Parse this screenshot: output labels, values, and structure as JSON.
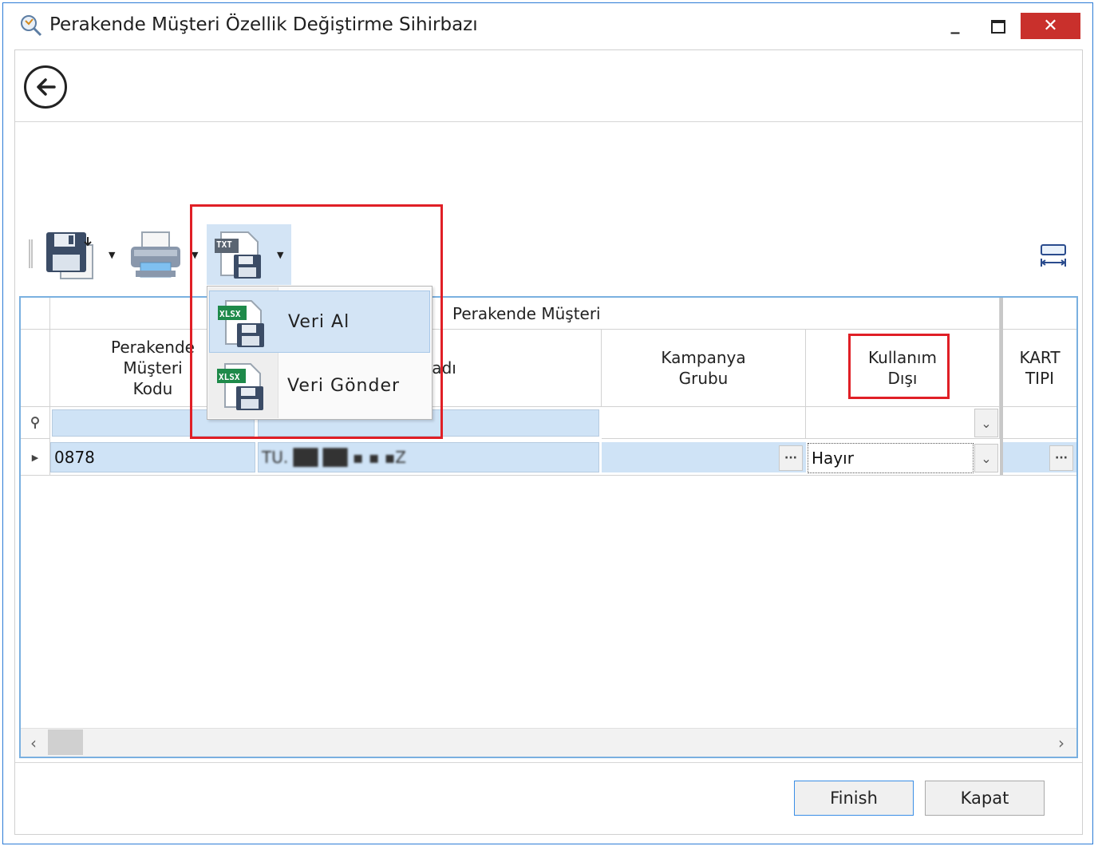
{
  "window": {
    "title": "Perakende Müşteri Özellik Değiştirme Sihirbazı",
    "minimize_symbol": "_",
    "maximize_symbol": "☐",
    "close_symbol": "✕"
  },
  "nav": {
    "back_icon": "arrow-left-circle-icon"
  },
  "toolbar": {
    "buttons": [
      {
        "icon": "save-icon"
      },
      {
        "icon": "print-icon"
      },
      {
        "icon": "txt-export-icon",
        "icon_text": "TXT"
      }
    ],
    "right_icon": "best-fit-columns-icon"
  },
  "dropdown_menu": {
    "items": [
      {
        "label": "Veri Al",
        "icon_text": "XLSX",
        "icon": "xlsx-import-icon"
      },
      {
        "label": "Veri Gönder",
        "icon_text": "XLSX",
        "icon": "xlsx-export-icon"
      }
    ]
  },
  "grid": {
    "band": "Perakende Müşteri",
    "columns": [
      {
        "label": "Perakende\nMüşteri\nKodu"
      },
      {
        "label": "Unvadı"
      },
      {
        "label": "Kampanya\nGrubu"
      },
      {
        "label": "Kullanım\nDışı"
      },
      {
        "label": "KART\nTIPI"
      }
    ],
    "rows": [
      {
        "code": "0878",
        "name": "TU. ██ ██ ▪ ▪ ▪Z",
        "kampanya": "",
        "kullanim": "Hayır",
        "kart": ""
      }
    ]
  },
  "footer": {
    "finish_label": "Finish",
    "kapat_label": "Kapat"
  },
  "colors": {
    "accent_border": "#2b7bd6",
    "highlight_red": "#e01f26",
    "selected_cell": "#cfe3f6",
    "close_button": "#c9302c"
  }
}
